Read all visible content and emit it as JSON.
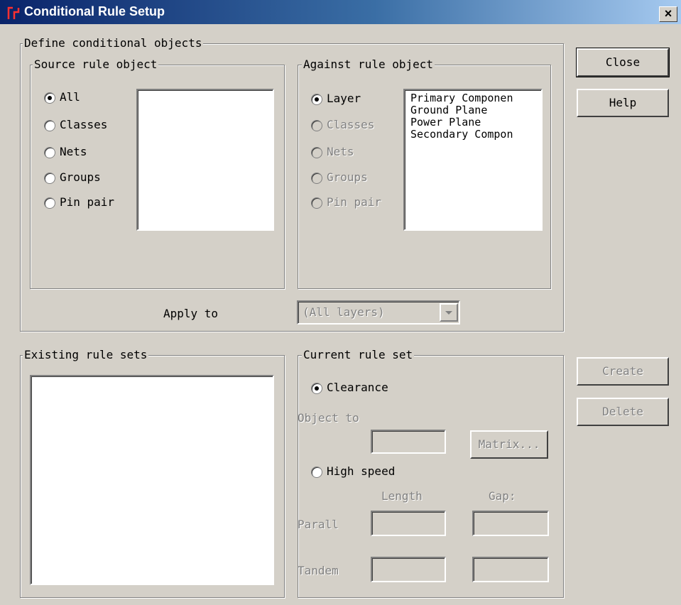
{
  "window": {
    "title": "Conditional Rule Setup",
    "close_glyph": "×",
    "icon": "app-icon"
  },
  "define_group": {
    "legend": "Define conditional objects",
    "source": {
      "legend": "Source rule object",
      "options": [
        {
          "label": "All",
          "selected": true,
          "enabled": true
        },
        {
          "label": "Classes",
          "selected": false,
          "enabled": true
        },
        {
          "label": "Nets",
          "selected": false,
          "enabled": true
        },
        {
          "label": "Groups",
          "selected": false,
          "enabled": true
        },
        {
          "label": "Pin pair",
          "selected": false,
          "enabled": true
        }
      ]
    },
    "against": {
      "legend": "Against rule object",
      "options": [
        {
          "label": "Layer",
          "selected": true,
          "enabled": true
        },
        {
          "label": "Classes",
          "selected": false,
          "enabled": false
        },
        {
          "label": "Nets",
          "selected": false,
          "enabled": false
        },
        {
          "label": "Groups",
          "selected": false,
          "enabled": false
        },
        {
          "label": "Pin pair",
          "selected": false,
          "enabled": false
        }
      ],
      "list": [
        "Primary Componen",
        "Ground Plane",
        "Power Plane",
        "Secondary Compon"
      ]
    },
    "apply_to": {
      "label": "Apply to",
      "value": "(All layers)"
    }
  },
  "existing": {
    "legend": "Existing rule sets"
  },
  "current": {
    "legend": "Current rule set",
    "clearance_label": "Clearance",
    "object_to_label": "Object to",
    "matrix_button": "Matrix...",
    "high_speed_label": "High speed",
    "length_label": "Length",
    "gap_label": "Gap:",
    "parallel_label": "Parall",
    "tandem_label": "Tandem"
  },
  "buttons": {
    "close": "Close",
    "help": "Help",
    "create": "Create",
    "delete": "Delete"
  }
}
